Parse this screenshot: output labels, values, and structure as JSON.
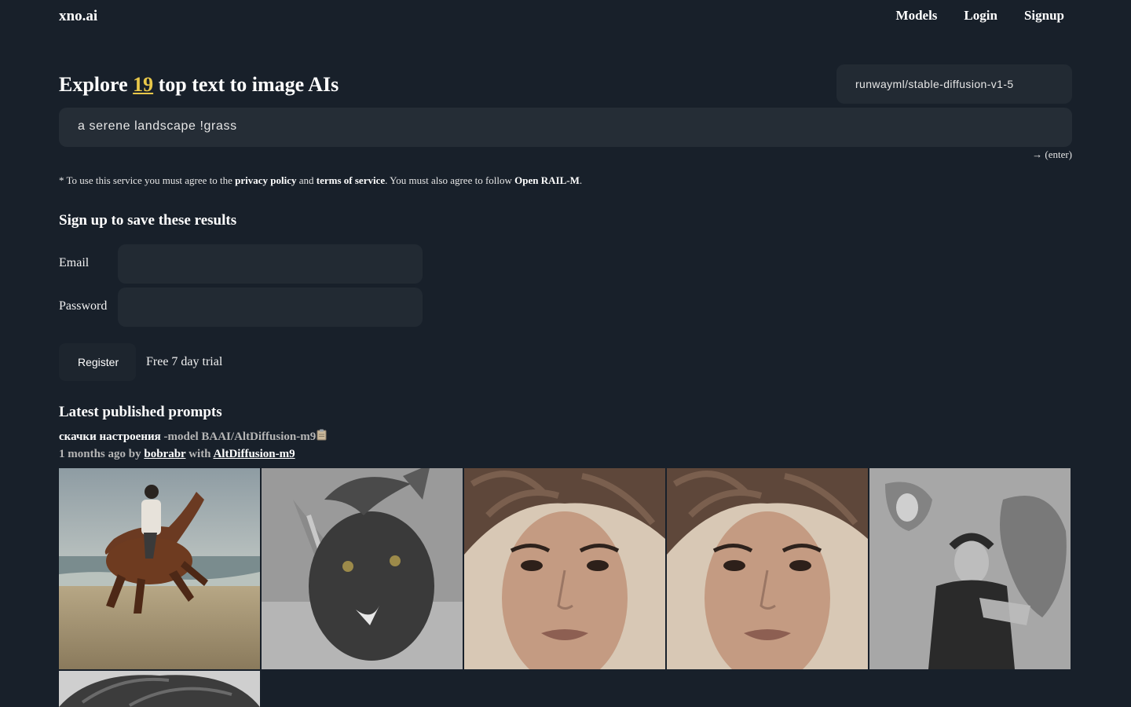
{
  "nav": {
    "brand": "xno.ai",
    "links": [
      "Models",
      "Login",
      "Signup"
    ]
  },
  "hero": {
    "prefix": "Explore",
    "count": "19",
    "suffix": "top text to image AIs"
  },
  "model_select": {
    "value": "runwayml/stable-diffusion-v1-5"
  },
  "prompt": {
    "value": "a serene landscape !grass"
  },
  "enter_hint": "→ (enter)",
  "disclaimer": {
    "p1": "* To use this service you must agree to the ",
    "privacy": "privacy policy",
    "p2": " and ",
    "terms": "terms of service",
    "p3": ". You must also agree to follow ",
    "license": "Open RAIL-M",
    "p4": "."
  },
  "signup": {
    "title": "Sign up to save these results",
    "email_label": "Email",
    "password_label": "Password",
    "register_label": "Register",
    "trial_text": "Free 7 day trial"
  },
  "latest": {
    "title": "Latest published prompts",
    "prompt_text": "скачки настроения",
    "model_flag": " -model BAAI/AltDiffusion-m9",
    "copy_icon": "clipboard-icon",
    "age": "1 months ago by ",
    "user": "bobrabr",
    "with": " with ",
    "model_link": "AltDiffusion-m9"
  },
  "gallery": [
    {
      "name": "horse-rider-beach-image"
    },
    {
      "name": "grey-creature-image"
    },
    {
      "name": "portrait-woman-image-1"
    },
    {
      "name": "portrait-woman-image-2"
    },
    {
      "name": "bw-surreal-man-image"
    },
    {
      "name": "hair-closeup-image"
    }
  ],
  "colors": {
    "background": "#18202a",
    "accent": "#e9c84a",
    "input_bg": "#252d36"
  }
}
